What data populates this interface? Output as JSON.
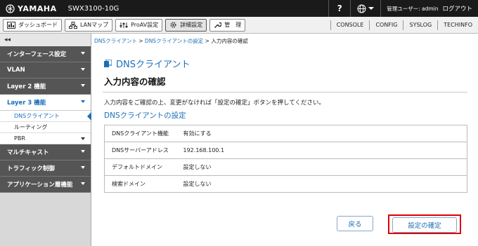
{
  "header": {
    "logo": "YAMAHA",
    "model": "SWX3100-10G",
    "help": "?",
    "user": "管理ユーザー: admin",
    "logout": "ログアウト"
  },
  "tabs": [
    {
      "label": "ダッシュボード",
      "icon": "dashboard-icon"
    },
    {
      "label": "LANマップ",
      "icon": "lan-map-icon"
    },
    {
      "label": "ProAV設定",
      "icon": "proav-icon"
    },
    {
      "label": "詳細設定",
      "icon": "gear-icon",
      "active": true
    },
    {
      "label": "管　理",
      "icon": "wrench-icon"
    }
  ],
  "toplinks": [
    "CONSOLE",
    "CONFIG",
    "SYSLOG",
    "TECHINFO"
  ],
  "sidebar": {
    "collapse": "◂◂",
    "items": [
      {
        "label": "インターフェース設定"
      },
      {
        "label": "VLAN"
      },
      {
        "label": "Layer 2 機能"
      },
      {
        "label": "Layer 3 機能",
        "open": true,
        "children": [
          {
            "label": "DNSクライアント",
            "active": true
          },
          {
            "label": "ルーティング"
          },
          {
            "label": "PBR"
          }
        ]
      },
      {
        "label": "マルチキャスト"
      },
      {
        "label": "トラフィック制御"
      },
      {
        "label": "アプリケーション層機能"
      }
    ]
  },
  "main": {
    "breadcrumb": {
      "link1": "DNSクライアント",
      "sep": " > ",
      "link2": "DNSクライアントの設定",
      "current": "入力内容の確認"
    },
    "title": "DNSクライアント",
    "subtitle": "入力内容の確認",
    "instruction": "入力内容をご確認の上、変更がなければ「設定の確定」ボタンを押してください。",
    "section_title": "DNSクライアントの設定",
    "rows": [
      {
        "key": "DNSクライアント機能",
        "value": "有効にする"
      },
      {
        "key": "DNSサーバーアドレス",
        "value": "192.168.100.1"
      },
      {
        "key": "デフォルトドメイン",
        "value": "設定しない"
      },
      {
        "key": "検索ドメイン",
        "value": "設定しない"
      }
    ],
    "back_button": "戻る",
    "confirm_button": "設定の確定"
  },
  "colors": {
    "accent": "#1b6fb8",
    "highlight": "#dd0000",
    "topbar": "#1a1a1a",
    "nav": "#555555"
  }
}
